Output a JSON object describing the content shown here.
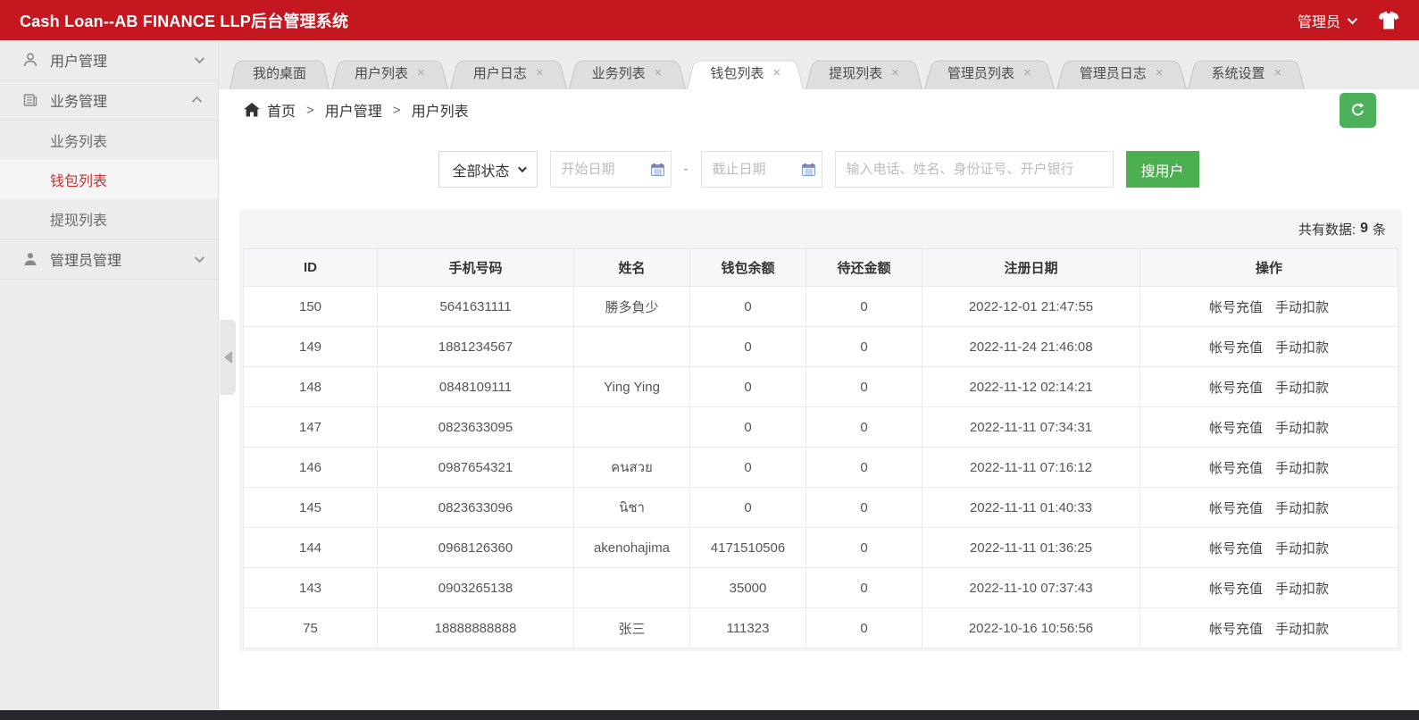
{
  "topbar": {
    "title": "Cash Loan--AB FINANCE LLP后台管理系统",
    "admin_label": "管理员"
  },
  "sidebar": {
    "groups": [
      {
        "label": "用户管理",
        "icon": "user-icon",
        "state": "collapsed"
      },
      {
        "label": "业务管理",
        "icon": "business-icon",
        "state": "expanded",
        "children": [
          {
            "label": "业务列表",
            "active": false
          },
          {
            "label": "钱包列表",
            "active": true
          },
          {
            "label": "提现列表",
            "active": false
          }
        ]
      },
      {
        "label": "管理员管理",
        "icon": "admin-icon",
        "state": "collapsed"
      }
    ]
  },
  "tabs": [
    {
      "label": "我的桌面",
      "closable": false,
      "active": false
    },
    {
      "label": "用户列表",
      "closable": true,
      "active": false
    },
    {
      "label": "用户日志",
      "closable": true,
      "active": false
    },
    {
      "label": "业务列表",
      "closable": true,
      "active": false
    },
    {
      "label": "钱包列表",
      "closable": true,
      "active": true
    },
    {
      "label": "提现列表",
      "closable": true,
      "active": false
    },
    {
      "label": "管理员列表",
      "closable": true,
      "active": false
    },
    {
      "label": "管理员日志",
      "closable": true,
      "active": false
    },
    {
      "label": "系统设置",
      "closable": true,
      "active": false
    }
  ],
  "breadcrumb": {
    "home": "首页",
    "separator": ">",
    "items": [
      "用户管理",
      "用户列表"
    ]
  },
  "filters": {
    "status_select": "全部状态",
    "start_date_placeholder": "开始日期",
    "end_date_placeholder": "截止日期",
    "date_separator": "-",
    "search_placeholder": "输入电话、姓名、身份证号、开户银行",
    "search_button": "搜用户"
  },
  "table": {
    "summary_prefix": "共有数据:",
    "summary_count": "9",
    "summary_suffix": "条",
    "columns": [
      "ID",
      "手机号码",
      "姓名",
      "钱包余额",
      "待还金额",
      "注册日期",
      "操作"
    ],
    "actions": [
      "帐号充值",
      "手动扣款"
    ],
    "rows": [
      {
        "id": "150",
        "phone": "5641631111",
        "name": "勝多負少",
        "balance": "0",
        "due": "0",
        "date": "2022-12-01 21:47:55"
      },
      {
        "id": "149",
        "phone": "1881234567",
        "name": "",
        "balance": "0",
        "due": "0",
        "date": "2022-11-24 21:46:08"
      },
      {
        "id": "148",
        "phone": "0848109111",
        "name": "Ying Ying",
        "balance": "0",
        "due": "0",
        "date": "2022-11-12 02:14:21"
      },
      {
        "id": "147",
        "phone": "0823633095",
        "name": "",
        "balance": "0",
        "due": "0",
        "date": "2022-11-11 07:34:31"
      },
      {
        "id": "146",
        "phone": "0987654321",
        "name": "คนสวย",
        "balance": "0",
        "due": "0",
        "date": "2022-11-11 07:16:12"
      },
      {
        "id": "145",
        "phone": "0823633096",
        "name": "นิชา",
        "balance": "0",
        "due": "0",
        "date": "2022-11-11 01:40:33"
      },
      {
        "id": "144",
        "phone": "0968126360",
        "name": "akenohajima",
        "balance": "4171510506",
        "due": "0",
        "date": "2022-11-11 01:36:25"
      },
      {
        "id": "143",
        "phone": "0903265138",
        "name": "",
        "balance": "35000",
        "due": "0",
        "date": "2022-11-10 07:37:43"
      },
      {
        "id": "75",
        "phone": "18888888888",
        "name": "张三",
        "balance": "111323",
        "due": "0",
        "date": "2022-10-16 10:56:56"
      }
    ]
  },
  "colors": {
    "topbar_bg": "#C5171F",
    "accent_green": "#4CAF50",
    "active_menu_text": "#C9302C",
    "sidebar_bg": "#ECECEC"
  }
}
